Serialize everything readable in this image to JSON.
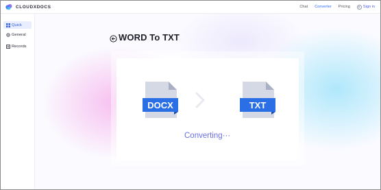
{
  "brand": {
    "name": "CLOUDXDOCS"
  },
  "nav": {
    "items": [
      {
        "label": "Chat",
        "active": false
      },
      {
        "label": "Converter",
        "active": true
      },
      {
        "label": "Pricing",
        "active": false
      }
    ],
    "signin_label": "Sign in"
  },
  "sidebar": {
    "items": [
      {
        "label": "Quick",
        "icon": "grid-icon",
        "active": true
      },
      {
        "label": "General",
        "icon": "cycle-icon",
        "active": false
      },
      {
        "label": "Records",
        "icon": "records-icon",
        "active": false
      }
    ]
  },
  "main": {
    "title": "WORD To TXT",
    "source_format": "DOCX",
    "target_format": "TXT",
    "status": "Converting···"
  },
  "colors": {
    "accent": "#2f6bff",
    "file_label_bg": "#2b6fe6",
    "file_body": "#d5d9e6",
    "status_text": "#6b6fe0"
  }
}
